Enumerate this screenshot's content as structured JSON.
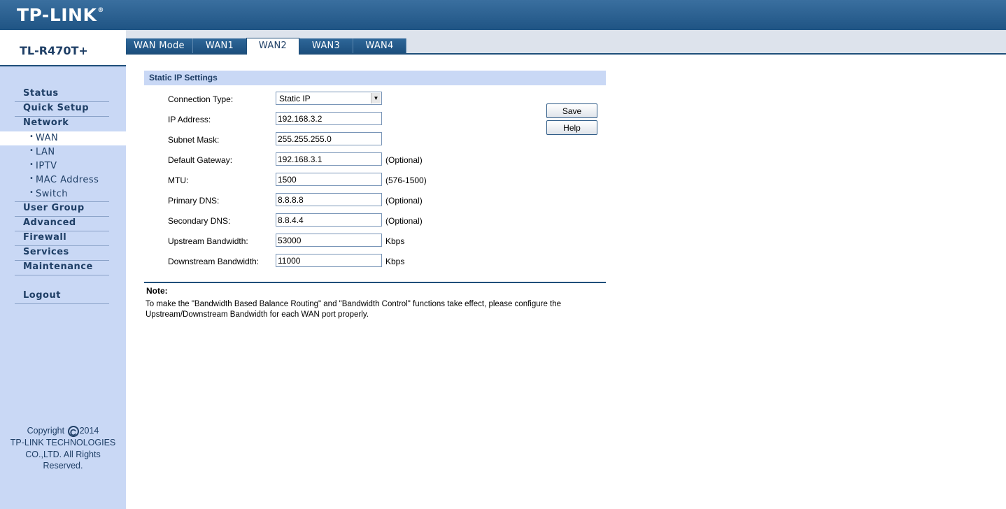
{
  "header": {
    "logo": "TP-LINK",
    "logo_mark": "®"
  },
  "sidebar": {
    "model": "TL-R470T+",
    "menu": [
      {
        "label": "Status"
      },
      {
        "label": "Quick Setup"
      },
      {
        "label": "Network"
      },
      {
        "label": "User Group"
      },
      {
        "label": "Advanced"
      },
      {
        "label": "Firewall"
      },
      {
        "label": "Services"
      },
      {
        "label": "Maintenance"
      },
      {
        "label": "Logout"
      }
    ],
    "network_sub": [
      {
        "label": "WAN",
        "active": true
      },
      {
        "label": "LAN"
      },
      {
        "label": "IPTV"
      },
      {
        "label": "MAC Address"
      },
      {
        "label": "Switch"
      }
    ],
    "copyright": {
      "line1a": "Copyright",
      "symbol": "C",
      "line1b": "2014",
      "line2": "TP-LINK TECHNOLOGIES",
      "line3": "CO.,LTD. All Rights",
      "line4": "Reserved."
    }
  },
  "tabs": [
    {
      "label": "WAN Mode"
    },
    {
      "label": "WAN1"
    },
    {
      "label": "WAN2",
      "active": true
    },
    {
      "label": "WAN3"
    },
    {
      "label": "WAN4"
    }
  ],
  "section": {
    "title": "Static IP Settings"
  },
  "form": {
    "connection_type": {
      "label": "Connection Type:",
      "value": "Static IP"
    },
    "ip_address": {
      "label": "IP Address:",
      "value": "192.168.3.2"
    },
    "subnet_mask": {
      "label": "Subnet Mask:",
      "value": "255.255.255.0"
    },
    "default_gateway": {
      "label": "Default Gateway:",
      "value": "192.168.3.1",
      "hint": "(Optional)"
    },
    "mtu": {
      "label": "MTU:",
      "value": "1500",
      "hint": "(576-1500)"
    },
    "primary_dns": {
      "label": "Primary DNS:",
      "value": "8.8.8.8",
      "hint": "(Optional)"
    },
    "secondary_dns": {
      "label": "Secondary DNS:",
      "value": "8.8.4.4",
      "hint": "(Optional)"
    },
    "upstream_bw": {
      "label": "Upstream Bandwidth:",
      "value": "53000",
      "hint": "Kbps"
    },
    "downstream_bw": {
      "label": "Downstream Bandwidth:",
      "value": "11000",
      "hint": "Kbps"
    }
  },
  "buttons": {
    "save": "Save",
    "help": "Help"
  },
  "note": {
    "title": "Note:",
    "text": "To make the \"Bandwidth Based Balance Routing\" and \"Bandwidth Control\" functions take effect, please configure the Upstream/Downstream Bandwidth for each WAN port properly."
  },
  "colors": {
    "header": "#1f5484",
    "sidebar": "#c9d8f5",
    "nav_text": "#1f3f66"
  }
}
